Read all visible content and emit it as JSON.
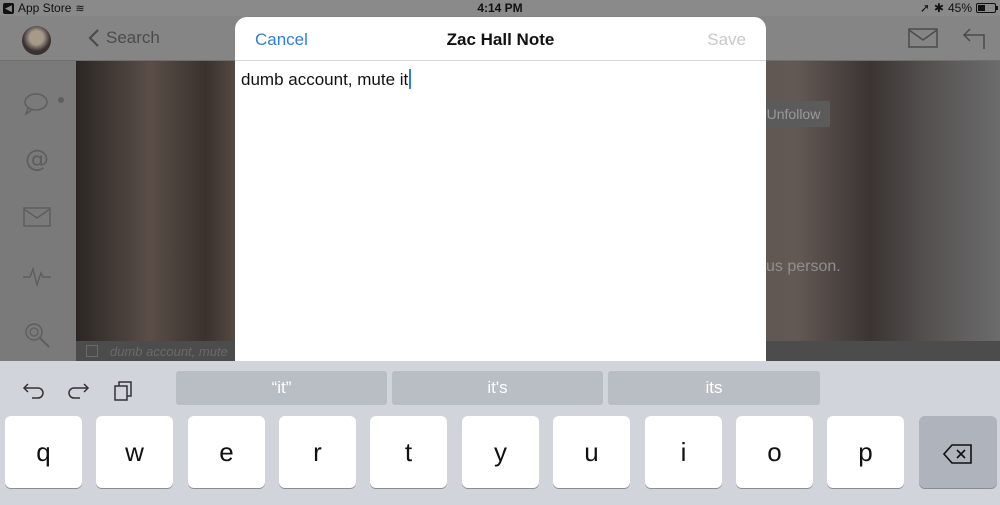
{
  "status_bar": {
    "back_app": "App Store",
    "time": "4:14 PM",
    "battery": "45%",
    "battery_level": 0.45
  },
  "background": {
    "back_label": "Search",
    "unfollow_label": "Unfollow",
    "bio_fragment": "us person.",
    "note_preview": "dumb account, mute"
  },
  "modal": {
    "cancel_label": "Cancel",
    "title": "Zac Hall Note",
    "save_label": "Save",
    "note_text": "dumb account, mute it"
  },
  "keyboard": {
    "suggestions": [
      "“it”",
      "it's",
      "its"
    ],
    "keys": [
      "q",
      "w",
      "e",
      "r",
      "t",
      "y",
      "u",
      "i",
      "o",
      "p"
    ]
  },
  "colors": {
    "accent": "#2f7fd6",
    "disabled": "#c8c8c8",
    "keyboard_bg": "#d1d4da"
  }
}
